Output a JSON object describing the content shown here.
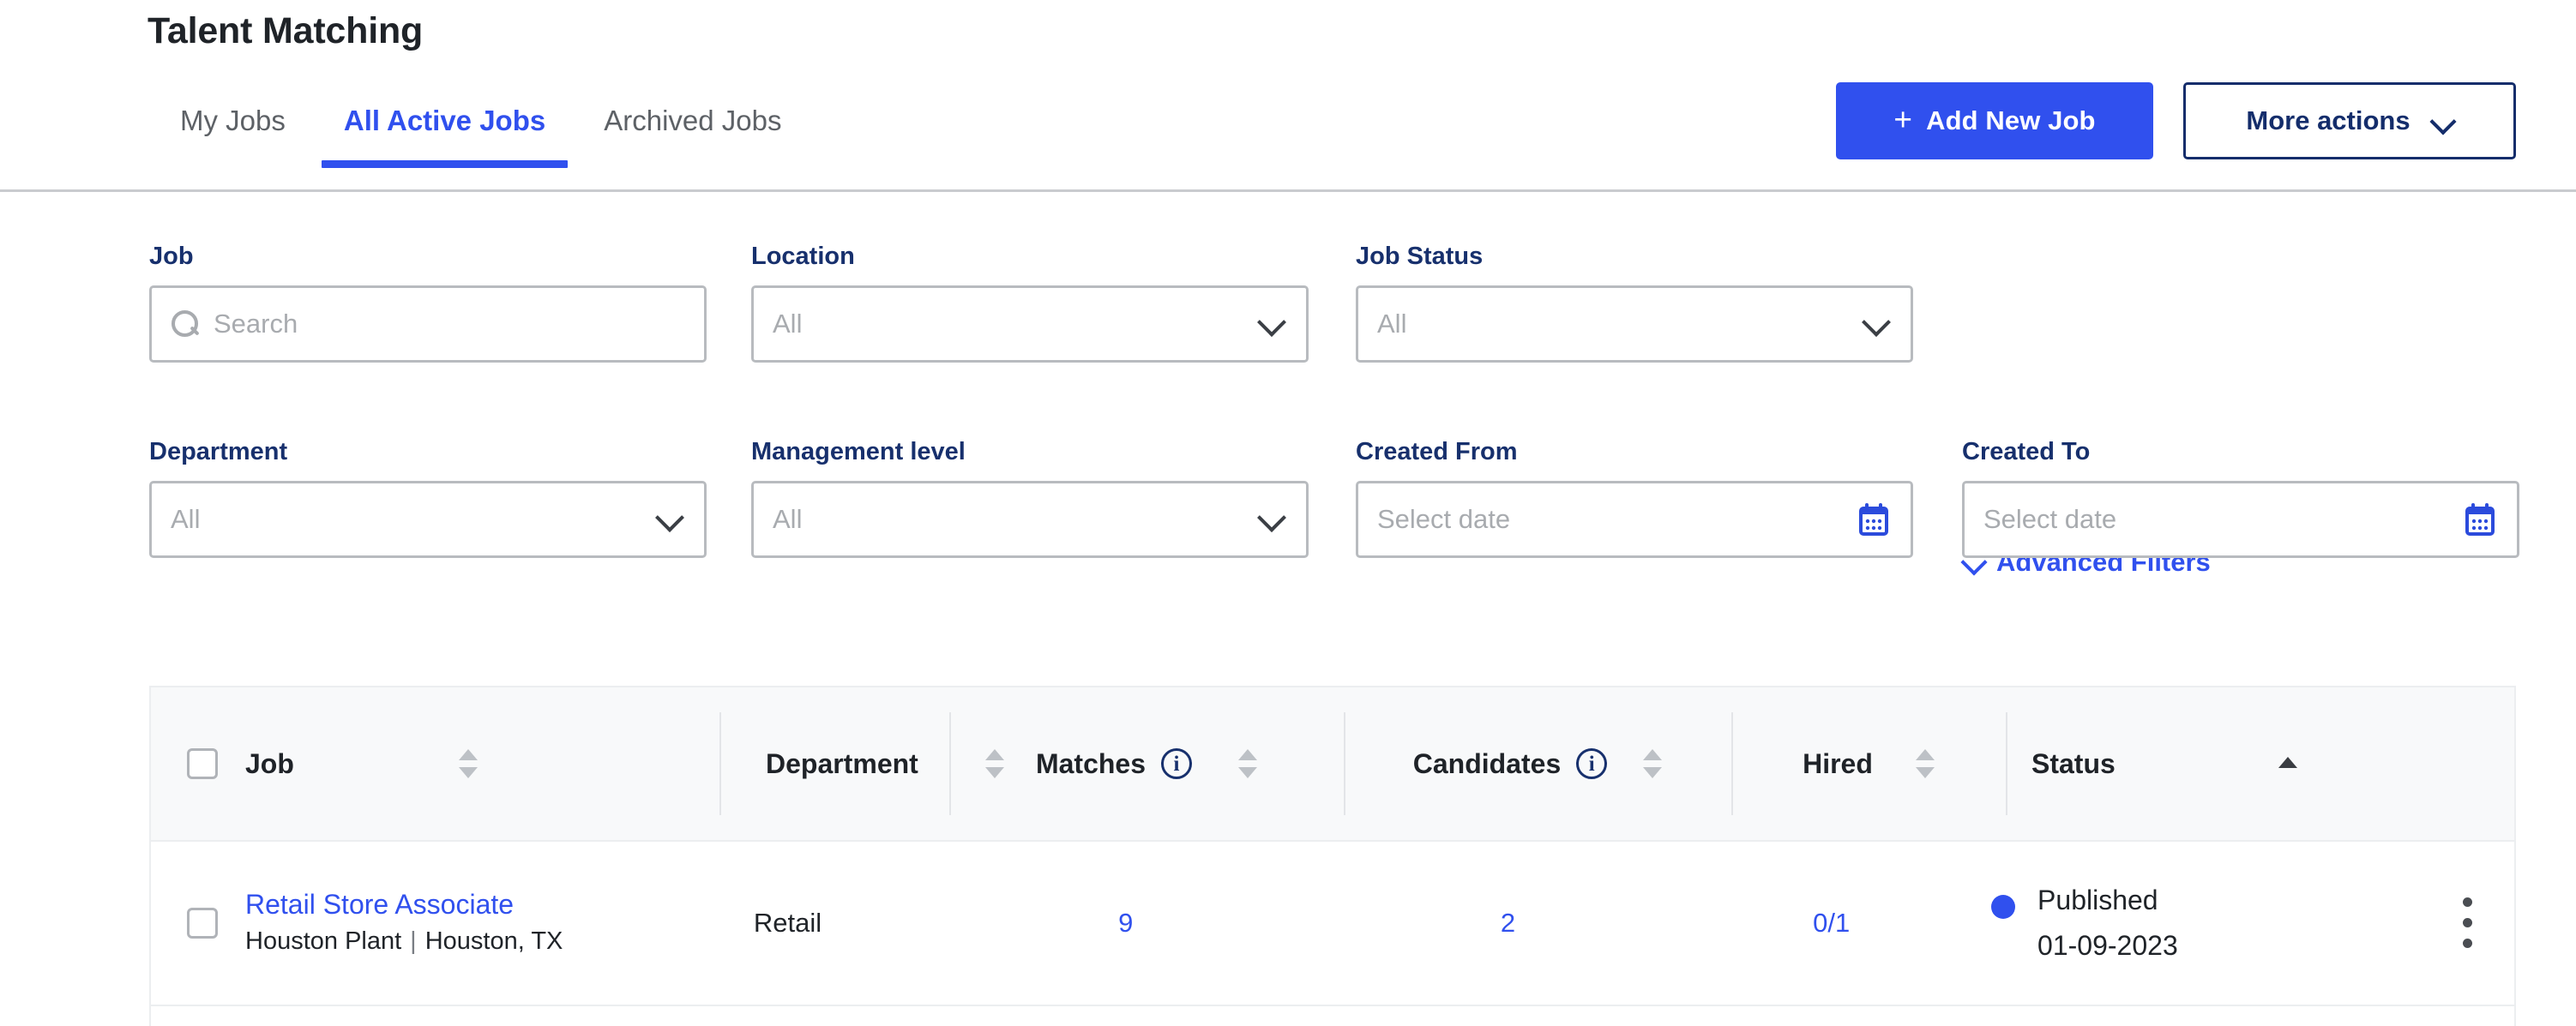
{
  "header": {
    "title": "Talent Matching",
    "tabs": [
      {
        "label": "My Jobs",
        "active": false
      },
      {
        "label": "All Active Jobs",
        "active": true
      },
      {
        "label": "Archived Jobs",
        "active": false
      }
    ],
    "add_button": {
      "label": "Add New Job",
      "plus": "+"
    },
    "more_button": {
      "label": "More actions",
      "icon": "chevron-down-icon"
    },
    "accent_color": "#3050ee",
    "navy_color": "#142d6b"
  },
  "filters": {
    "advanced_link": "Advanced Filters",
    "row1": [
      {
        "label": "Job",
        "value": "",
        "placeholder": "Search",
        "type": "search"
      },
      {
        "label": "Location",
        "value": "",
        "placeholder": "All",
        "type": "select"
      },
      {
        "label": "Job Status",
        "value": "",
        "placeholder": "All",
        "type": "select"
      }
    ],
    "row2": [
      {
        "label": "Department",
        "value": "",
        "placeholder": "All",
        "type": "select"
      },
      {
        "label": "Management level",
        "value": "",
        "placeholder": "All",
        "type": "select"
      },
      {
        "label": "Created From",
        "value": "",
        "placeholder": "Select date",
        "type": "date"
      },
      {
        "label": "Created To",
        "value": "",
        "placeholder": "Select date",
        "type": "date"
      }
    ]
  },
  "table": {
    "columns": [
      {
        "key": "job",
        "label": "Job",
        "sort": "none",
        "info": false
      },
      {
        "key": "department",
        "label": "Department",
        "sort": "none",
        "info": false
      },
      {
        "key": "matches",
        "label": "Matches",
        "sort": "none",
        "info": true
      },
      {
        "key": "candidates",
        "label": "Candidates",
        "sort": "none",
        "info": true
      },
      {
        "key": "hired",
        "label": "Hired",
        "sort": "none",
        "info": false
      },
      {
        "key": "status",
        "label": "Status",
        "sort": "asc",
        "info": false
      }
    ],
    "rows": [
      {
        "job_title": "Retail Store Associate",
        "job_plant": "Houston Plant",
        "job_sep": "|",
        "job_location": "Houston, TX",
        "department": "Retail",
        "matches": "9",
        "candidates": "2",
        "hired": "0/1",
        "status": "Published",
        "status_color": "#3050ee",
        "status_date": "01-09-2023"
      }
    ]
  }
}
